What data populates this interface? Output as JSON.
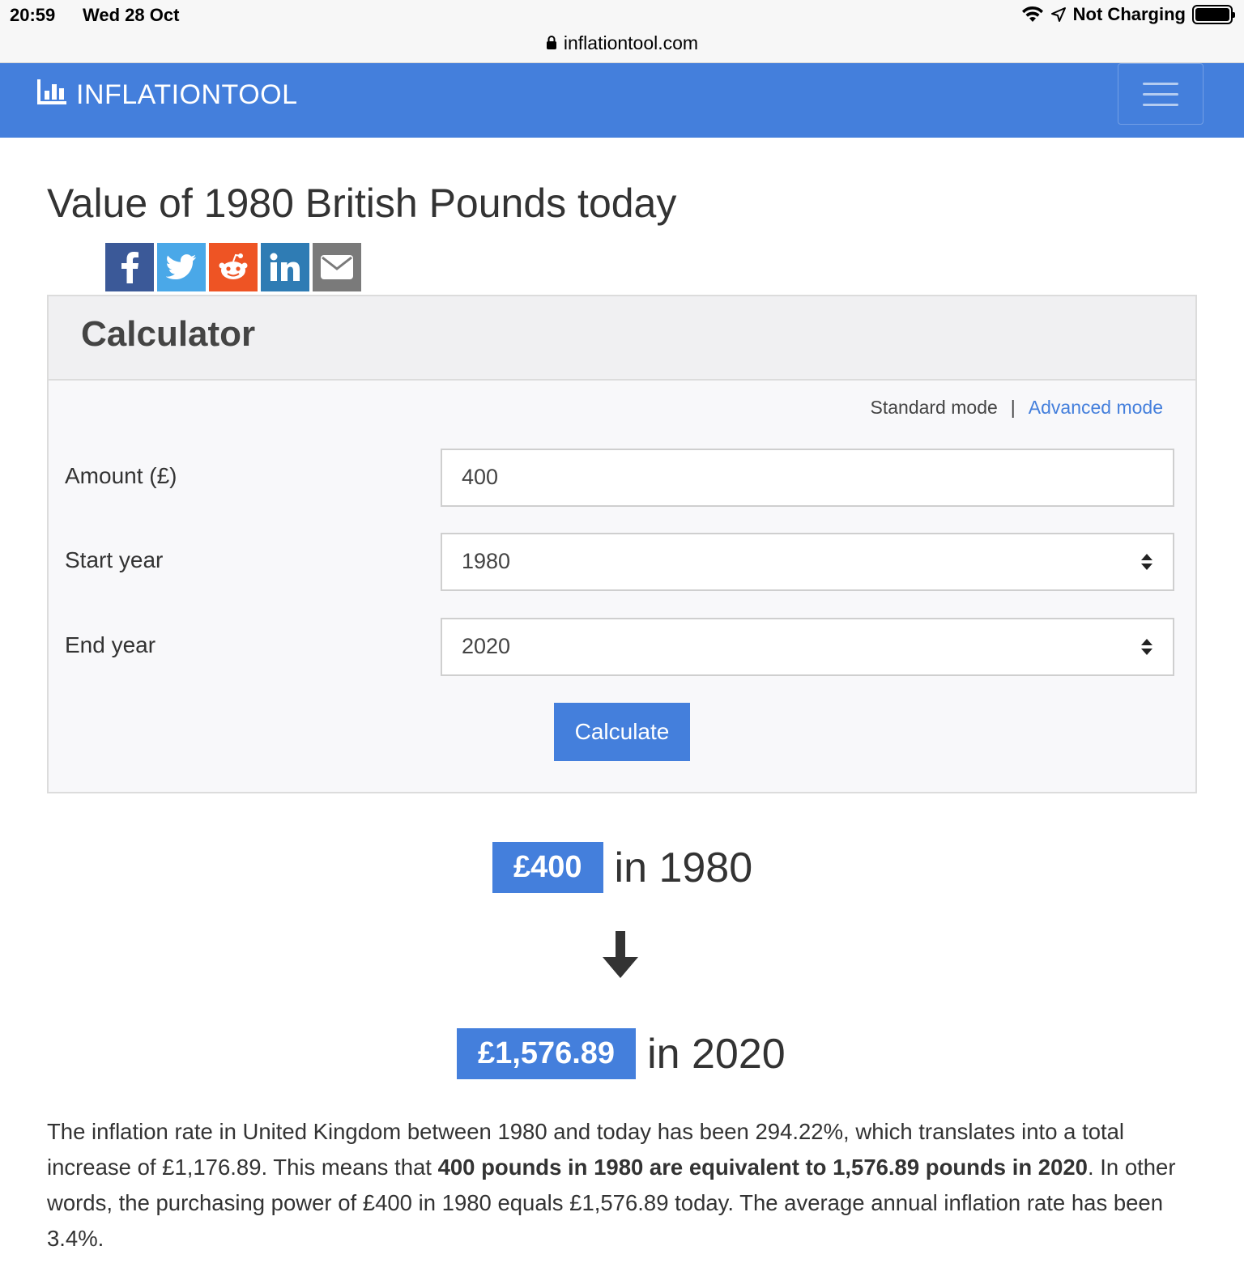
{
  "status_bar": {
    "time": "20:59",
    "date": "Wed 28 Oct",
    "battery_status": "Not Charging",
    "url": "inflationtool.com"
  },
  "navbar": {
    "brand": "INFLATIONTOOL",
    "brand_color": "#447fdc"
  },
  "page_title": "Value of 1980 British Pounds today",
  "share_icons": [
    "facebook-icon",
    "twitter-icon",
    "reddit-icon",
    "linkedin-icon",
    "email-icon"
  ],
  "calculator": {
    "title": "Calculator",
    "mode_standard": "Standard mode",
    "mode_separator": "|",
    "mode_advanced": "Advanced mode",
    "amount_label": "Amount (£)",
    "amount_value": "400",
    "start_label": "Start year",
    "start_value": "1980",
    "end_label": "End year",
    "end_value": "2020",
    "button": "Calculate"
  },
  "result": {
    "from_amount": "£400",
    "from_text": "in 1980",
    "to_amount": "£1,576.89",
    "to_text": "in 2020"
  },
  "paragraph": {
    "part1": "The inflation rate in United Kingdom between 1980 and today has been 294.22%, which translates into a total increase of £1,176.89. This means that ",
    "bold": "400 pounds in 1980 are equivalent to 1,576.89 pounds in 2020",
    "part2": ". In other words, the purchasing power of £400 in 1980 equals £1,576.89 today. The average annual inflation rate has been 3.4%."
  }
}
